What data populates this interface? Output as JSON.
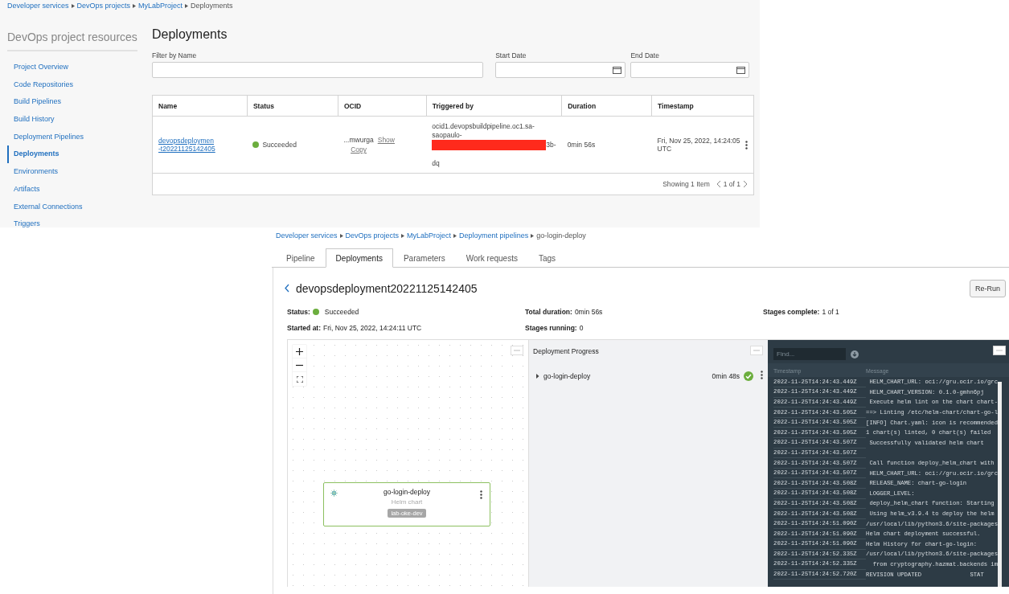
{
  "deployments_list": {
    "breadcrumb": [
      "Developer services",
      "DevOps projects",
      "MyLabProject",
      "Deployments"
    ],
    "sidebar": {
      "title": "DevOps project resources",
      "items": [
        {
          "label": "Project Overview",
          "selected": false
        },
        {
          "label": "Code Repositories",
          "selected": false
        },
        {
          "label": "Build Pipelines",
          "selected": false
        },
        {
          "label": "Build History",
          "selected": false
        },
        {
          "label": "Deployment Pipelines",
          "selected": false
        },
        {
          "label": "Deployments",
          "selected": true
        },
        {
          "label": "Environments",
          "selected": false
        },
        {
          "label": "Artifacts",
          "selected": false
        },
        {
          "label": "External Connections",
          "selected": false
        },
        {
          "label": "Triggers",
          "selected": false
        }
      ]
    },
    "title": "Deployments",
    "filters": [
      {
        "label": "Filter by Name",
        "kind": "text"
      },
      {
        "label": "Start Date",
        "kind": "date"
      },
      {
        "label": "End Date",
        "kind": "date"
      }
    ],
    "table": {
      "columns": [
        "Name",
        "Status",
        "OCID",
        "Triggered by",
        "Duration",
        "Timestamp"
      ],
      "rows": [
        {
          "name": "devopsdeploymen-t20221125142405",
          "status": "Succeeded",
          "color": "#6cae3e",
          "ocid": "...mwurga",
          "ocid_actions": [
            "Show",
            "Copy"
          ],
          "triggered_by": [
            "ocid1.devopsbuildpipeline.oc1.sa-",
            "saopaulo-",
            "3b-",
            "dq"
          ],
          "duration": "0min 56s",
          "timestamp": "Fri, Nov 25, 2022, 14:24:05 UTC"
        }
      ],
      "footer": {
        "count": "Showing 1 Item",
        "page": "1 of 1"
      }
    }
  },
  "deployment_detail": {
    "breadcrumb": [
      "Developer services",
      "DevOps projects",
      "MyLabProject",
      "Deployment pipelines",
      "go-login-deploy"
    ],
    "tabs": [
      {
        "label": "Pipeline",
        "selected": false
      },
      {
        "label": "Deployments",
        "selected": true
      },
      {
        "label": "Parameters",
        "selected": false
      },
      {
        "label": "Work requests",
        "selected": false
      },
      {
        "label": "Tags",
        "selected": false
      }
    ],
    "title": "devopsdeployment20221125142405",
    "action": "Re-Run",
    "info": [
      {
        "label": "Status:",
        "value": "Succeeded",
        "color": "#6cae3e"
      },
      {
        "label": "Total duration:",
        "value": "0min 56s"
      },
      {
        "label": "Stages complete:",
        "value": "1 of 1"
      },
      {
        "label": "Started at:",
        "value": "Fri, Nov 25, 2022, 14:24:11 UTC"
      },
      {
        "label": "Stages running:",
        "value": "0"
      }
    ],
    "node": {
      "title": "go-login-deploy",
      "subtitle": "Helm chart",
      "tag": "lab-oke-dev"
    },
    "progress": {
      "title": "Deployment Progress",
      "stages": [
        {
          "name": "go-login-deploy",
          "duration": "0min 48s",
          "color": "#6cae3e",
          "expanded": false
        }
      ]
    },
    "log": {
      "find_placeholder": "Find...",
      "columns": [
        "Timestamp",
        "Message"
      ],
      "rows": [
        [
          "2022-11-25T14:24:43.449Z",
          " HELM_CHART_URL: oci://gru.ocir.io/grc"
        ],
        [
          "2022-11-25T14:24:43.449Z",
          " HELM_CHART_VERSION: 0.1.0-gmhn6pj"
        ],
        [
          "2022-11-25T14:24:43.449Z",
          " Execute helm lint on the chart chart-"
        ],
        [
          "2022-11-25T14:24:43.505Z",
          "==> Linting /etc/helm-chart/chart-go-l"
        ],
        [
          "2022-11-25T14:24:43.505Z",
          "[INFO] Chart.yaml: icon is recommended"
        ],
        [
          "2022-11-25T14:24:43.505Z",
          "1 chart(s) linted, 0 chart(s) failed"
        ],
        [
          "2022-11-25T14:24:43.507Z",
          " Successfully validated helm chart"
        ],
        [
          "2022-11-25T14:24:43.507Z",
          ""
        ],
        [
          "2022-11-25T14:24:43.507Z",
          " Call function deploy_helm_chart with"
        ],
        [
          "2022-11-25T14:24:43.507Z",
          " HELM_CHART_URL: oci://gru.ocir.io/grc"
        ],
        [
          "2022-11-25T14:24:43.508Z",
          " RELEASE_NAME: chart-go-login"
        ],
        [
          "2022-11-25T14:24:43.508Z",
          " LOGGER_LEVEL:"
        ],
        [
          "2022-11-25T14:24:43.508Z",
          " deploy_helm_chart function: Starting"
        ],
        [
          "2022-11-25T14:24:43.508Z",
          " Using helm_v3.9.4 to deploy the helm"
        ],
        [
          "2022-11-25T14:24:51.090Z",
          "/usr/local/lib/python3.6/site-packages"
        ],
        [
          "2022-11-25T14:24:51.090Z",
          "Helm chart deployment successful."
        ],
        [
          "2022-11-25T14:24:51.090Z",
          "Helm History for chart-go-login:"
        ],
        [
          "2022-11-25T14:24:52.335Z",
          "/usr/local/lib/python3.6/site-packages"
        ],
        [
          "2022-11-25T14:24:52.335Z",
          "  from cryptography.hazmat.backends im"
        ],
        [
          "2022-11-25T14:24:52.720Z",
          "REVISION UPDATED              STAT"
        ]
      ]
    }
  }
}
